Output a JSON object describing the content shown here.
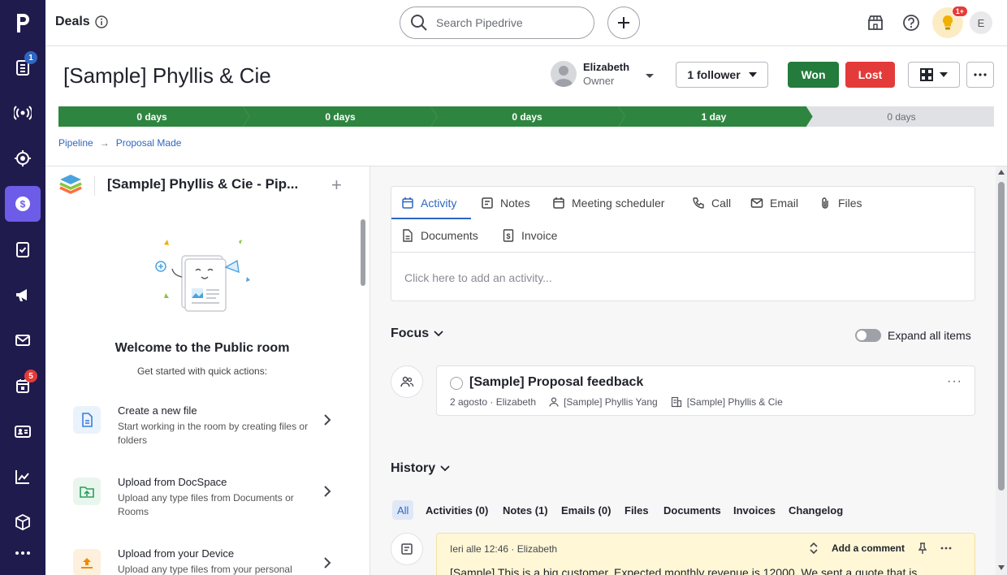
{
  "nav": {
    "badges": {
      "leads": "1",
      "activities": "5"
    },
    "accent": "#6c5ce7",
    "items": [
      "leads-icon",
      "broadcast-icon",
      "target-icon",
      "deals-icon",
      "tasks-icon",
      "campaigns-icon",
      "mail-icon",
      "calendar-icon",
      "contacts-icon",
      "insights-icon",
      "products-icon",
      "more-icon"
    ]
  },
  "header": {
    "title": "Deals",
    "search_placeholder": "Search Pipedrive",
    "tips_badge": "1+",
    "avatar_initial": "E"
  },
  "deal": {
    "title": "[Sample] Phyllis & Cie",
    "owner_name": "Elizabeth",
    "owner_role": "Owner",
    "follower_label": "1 follower",
    "won_label": "Won",
    "lost_label": "Lost",
    "won_color": "#237b3c",
    "lost_color": "#e33b39"
  },
  "pipeline": {
    "stages": [
      "0 days",
      "0 days",
      "0 days",
      "1 day",
      "0 days"
    ],
    "completed_stages": 4,
    "done_color": "#2e8540",
    "todo_color": "#e0e1e5"
  },
  "breadcrumb": {
    "pipeline": "Pipeline",
    "arrow": "→",
    "stage": "Proposal Made"
  },
  "left_panel": {
    "title": "[Sample] Phyllis & Cie - Pip...",
    "plus": "+",
    "welcome_title": "Welcome to the Public room",
    "welcome_sub": "Get started with quick actions:",
    "actions": [
      {
        "title": "Create a new file",
        "desc": "Start working in the room by creating files or folders"
      },
      {
        "title": "Upload from DocSpace",
        "desc": "Upload any type files from Documents or Rooms"
      },
      {
        "title": "Upload from your Device",
        "desc": "Upload any type files from your personal"
      }
    ]
  },
  "composer": {
    "tabs": [
      "Activity",
      "Notes",
      "Meeting scheduler",
      "Call",
      "Email",
      "Files",
      "Documents",
      "Invoice"
    ],
    "placeholder": "Click here to add an activity..."
  },
  "focus": {
    "title": "Focus",
    "expand_label": "Expand all items",
    "item_title": "[Sample] Proposal feedback",
    "item_date": "2 agosto · Elizabeth",
    "item_person": "[Sample] Phyllis Yang",
    "item_org": "[Sample] Phyllis & Cie",
    "more": "···"
  },
  "history": {
    "title": "History",
    "tabs": [
      "All",
      "Activities (0)",
      "Notes (1)",
      "Emails (0)",
      "Files",
      "Documents",
      "Invoices",
      "Changelog"
    ],
    "note_meta": "Ieri alle 12:46 · Elizabeth",
    "add_comment": "Add a comment",
    "note_text": "[Sample] This is a big customer. Expected monthly revenue is 12000. We sent a quote that is"
  }
}
